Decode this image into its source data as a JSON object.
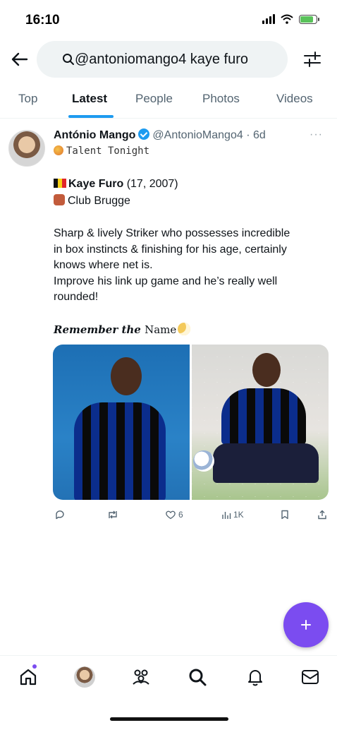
{
  "status_bar": {
    "time": "16:10"
  },
  "search": {
    "query": "@antoniomango4 kaye furo"
  },
  "tabs": [
    {
      "label": "Top",
      "active": false
    },
    {
      "label": "Latest",
      "active": true
    },
    {
      "label": "People",
      "active": false
    },
    {
      "label": "Photos",
      "active": false
    },
    {
      "label": "Videos",
      "active": false
    }
  ],
  "post": {
    "author": "António Mango",
    "handle": "@AntonioMango4 · 6d",
    "subtitle": "Talent Tonight",
    "player": "Kaye Furo",
    "player_details": " (17, 2007)",
    "club": "Club Brugge",
    "body": [
      "Sharp & lively Striker who possesses incredible",
      "in box instincts & finishing for his age, certainly",
      "knows where net is.",
      "Improve his link up game and he’s really well",
      "rounded!"
    ],
    "remember_prefix": "Remember the",
    "remember_name": "Name",
    "likes": "6",
    "views": "1K"
  },
  "colors": {
    "accent": "#1d9bf0",
    "fab": "#7b4cf0"
  },
  "icons": [
    "back-arrow-icon",
    "search-icon",
    "filter-icon",
    "reply-icon",
    "retweet-icon",
    "like-icon",
    "views-icon",
    "bookmark-icon",
    "share-icon",
    "compose-icon",
    "home-icon",
    "communities-icon",
    "search-icon",
    "notifications-icon",
    "messages-icon"
  ]
}
